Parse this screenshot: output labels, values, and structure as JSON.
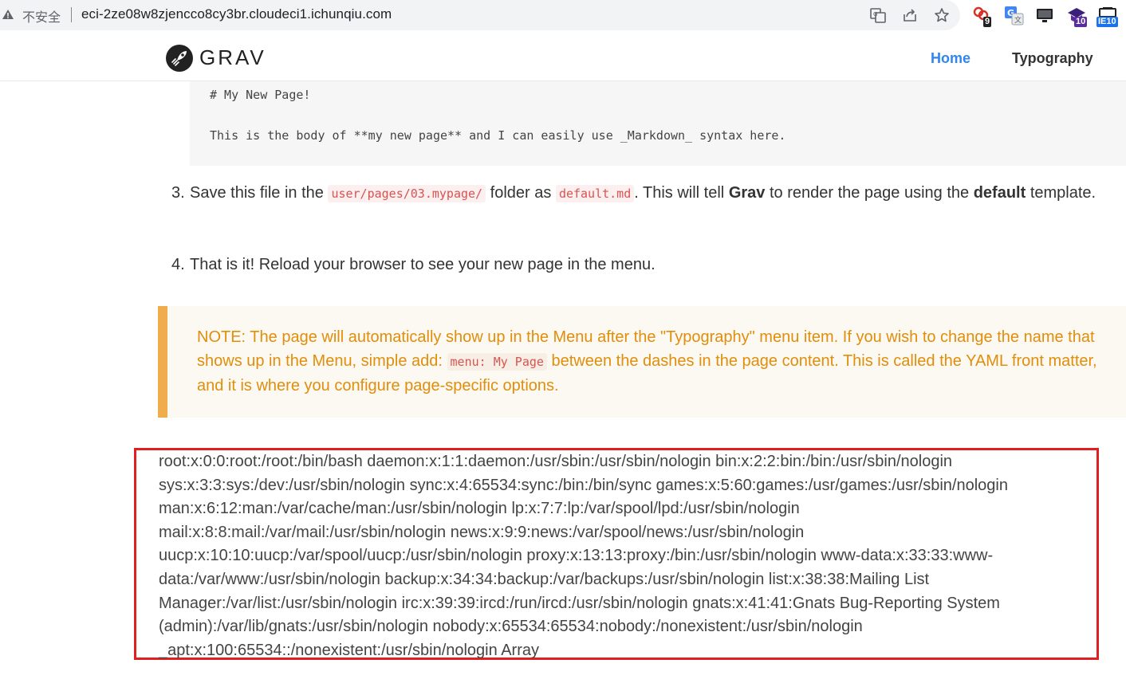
{
  "browser": {
    "security_label": "不安全",
    "url": "eci-2ze08w8zjencco8cy3br.cloudeci1.ichunqiu.com",
    "extensions": [
      {
        "icon": "chain-link-icon",
        "badge": "9"
      },
      {
        "icon": "translate-icon",
        "badge": ""
      },
      {
        "icon": "monitor-icon",
        "badge": ""
      },
      {
        "icon": "graduation-cap-icon",
        "badge": "10"
      },
      {
        "icon": "ie-tab-icon",
        "badge": "IE10"
      }
    ],
    "badge_color_dark": "#222222",
    "badge_color_purple": "#5b2c9e",
    "badge_color_blue": "#1a73e8"
  },
  "site": {
    "logo_text": "GRAV",
    "nav": [
      {
        "label": "Home",
        "active": true
      },
      {
        "label": "Typography",
        "active": false
      }
    ],
    "accent_color": "#3085ee"
  },
  "content": {
    "code_lines": [
      "# My New Page!",
      "This is the body of **my new page** and I can easily use _Markdown_ syntax here."
    ],
    "step3": {
      "number": "3.",
      "text_a": "Save this file in the",
      "code_a": "user/pages/03.mypage/",
      "text_b": "folder as",
      "code_b": "default.md",
      "text_c": ". This will tell",
      "bold_a": "Grav",
      "text_d": "to render the page using the",
      "bold_b": "default",
      "text_e": "template."
    },
    "step4": {
      "number": "4.",
      "text": "That is it! Reload your browser to see your new page in the menu."
    },
    "note": {
      "text_a": "NOTE: The page will automatically show up in the Menu after the \"Typography\" menu item. If you wish to change the name that shows up in the Menu, simple add:",
      "code": "menu: My Page",
      "text_b": "between the dashes in the page content. This is called the YAML front matter, and it is where you configure page-specific options."
    },
    "passwd_output": "root:x:0:0:root:/root:/bin/bash daemon:x:1:1:daemon:/usr/sbin:/usr/sbin/nologin bin:x:2:2:bin:/bin:/usr/sbin/nologin sys:x:3:3:sys:/dev:/usr/sbin/nologin sync:x:4:65534:sync:/bin:/bin/sync games:x:5:60:games:/usr/games:/usr/sbin/nologin man:x:6:12:man:/var/cache/man:/usr/sbin/nologin lp:x:7:7:lp:/var/spool/lpd:/usr/sbin/nologin mail:x:8:8:mail:/var/mail:/usr/sbin/nologin news:x:9:9:news:/var/spool/news:/usr/sbin/nologin uucp:x:10:10:uucp:/var/spool/uucp:/usr/sbin/nologin proxy:x:13:13:proxy:/bin:/usr/sbin/nologin www-data:x:33:33:www-data:/var/www:/usr/sbin/nologin backup:x:34:34:backup:/var/backups:/usr/sbin/nologin list:x:38:38:Mailing List Manager:/var/list:/usr/sbin/nologin irc:x:39:39:ircd:/run/ircd:/usr/sbin/nologin gnats:x:41:41:Gnats Bug-Reporting System (admin):/var/lib/gnats:/usr/sbin/nologin nobody:x:65534:65534:nobody:/nonexistent:/usr/sbin/nologin _apt:x:100:65534::/nonexistent:/usr/sbin/nologin Array",
    "note_color": "#f0ad4e",
    "highlight_border_color": "#e02020"
  }
}
